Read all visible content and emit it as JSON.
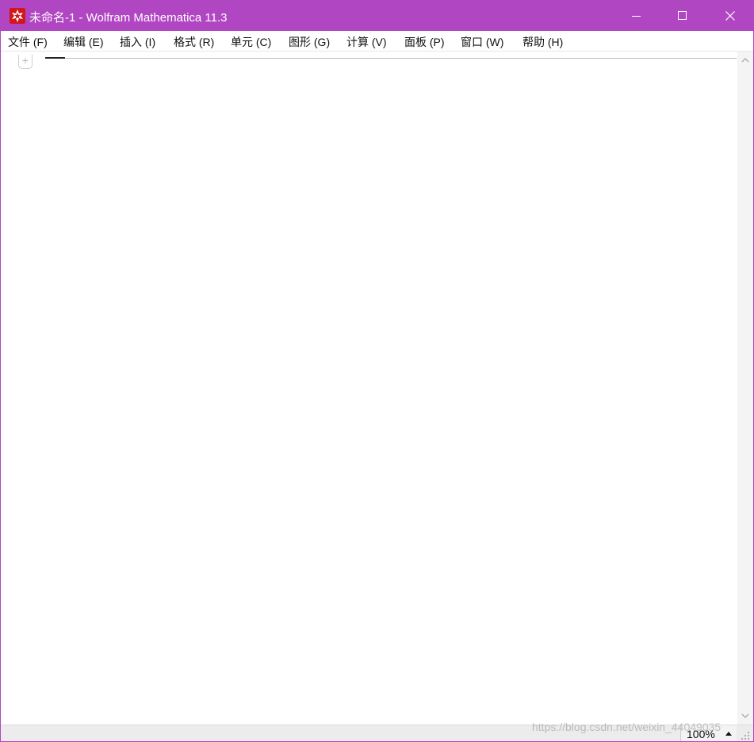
{
  "window": {
    "title": "未命名-1 - Wolfram Mathematica 11.3",
    "accent_color": "#b146c2",
    "icons": {
      "app": "mathematica-spikey-icon",
      "minimize": "minimize-icon",
      "maximize": "maximize-icon",
      "close": "close-icon"
    }
  },
  "menu": [
    {
      "label": "文件 (F)"
    },
    {
      "label": "编辑 (E)"
    },
    {
      "label": "插入 (I)"
    },
    {
      "label": "格式 (R)"
    },
    {
      "label": "单元 (C)"
    },
    {
      "label": "图形 (G)"
    },
    {
      "label": "计算 (V)"
    },
    {
      "label": "面板 (P)"
    },
    {
      "label": "窗口 (W)"
    },
    {
      "label": "帮助 (H)"
    }
  ],
  "notebook": {
    "cell_insert_symbol": "+"
  },
  "status": {
    "zoom": "100%"
  },
  "watermark": "https://blog.csdn.net/weixin_44049035"
}
